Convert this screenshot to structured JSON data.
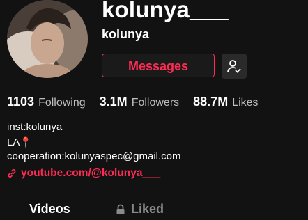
{
  "profile": {
    "username": "kolunya___",
    "nickname": "kolunya",
    "avatar_icon": "profile-photo"
  },
  "actions": {
    "messages_label": "Messages",
    "follow_icon": "user-check-icon"
  },
  "stats": [
    {
      "value": "1103",
      "label": "Following"
    },
    {
      "value": "3.1M",
      "label": "Followers"
    },
    {
      "value": "88.7M",
      "label": "Likes"
    }
  ],
  "bio": {
    "line1": "inst:kolunya___",
    "line2": "LA",
    "line2_icon": "pin-icon",
    "line3": "cooperation:kolunyaspec@gmail.com"
  },
  "link": {
    "text": "youtube.com/@kolunya___",
    "icon": "link-icon"
  },
  "tabs": {
    "videos": "Videos",
    "liked": "Liked",
    "liked_icon": "lock-icon"
  },
  "colors": {
    "accent": "#fe2c55",
    "background": "#121212"
  }
}
